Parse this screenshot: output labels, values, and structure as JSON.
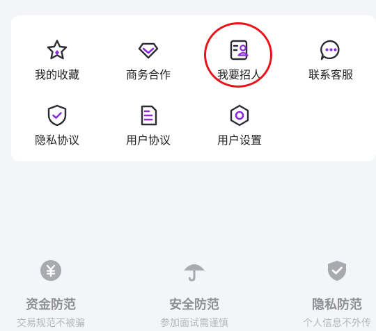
{
  "menu": {
    "items": [
      {
        "label": "我的收藏",
        "icon": "star-icon"
      },
      {
        "label": "商务合作",
        "icon": "diamond-icon"
      },
      {
        "label": "我要招人",
        "icon": "recruit-icon"
      },
      {
        "label": "联系客服",
        "icon": "chat-icon"
      },
      {
        "label": "隐私协议",
        "icon": "shield-check-icon"
      },
      {
        "label": "用户协议",
        "icon": "document-icon"
      },
      {
        "label": "用户设置",
        "icon": "settings-hex-icon"
      }
    ]
  },
  "guarantees": [
    {
      "title": "资金防范",
      "subtitle": "交易规范不被骗",
      "icon": "coin-icon"
    },
    {
      "title": "安全防范",
      "subtitle": "参加面试需谨慎",
      "icon": "umbrella-icon"
    },
    {
      "title": "隐私防范",
      "subtitle": "个人信息不外传",
      "icon": "shield-icon"
    }
  ],
  "colors": {
    "accent": "#8a2be2",
    "highlight": "#e8141c",
    "muted": "#8e8f94"
  }
}
